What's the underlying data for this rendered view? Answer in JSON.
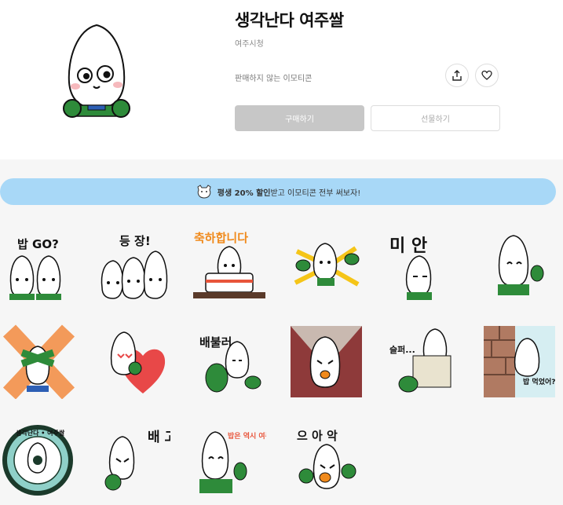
{
  "product": {
    "title": "생각난다 여주쌀",
    "author": "여주시청",
    "sale_status": "판매하지 않는 이모티콘",
    "buy_label": "구매하기",
    "gift_label": "선물하기"
  },
  "icons": {
    "share": "share-icon",
    "like": "heart-icon"
  },
  "banner": {
    "highlight": "평생 20% 할인",
    "rest": " 받고 이모티콘 전부 써보자!"
  },
  "stickers": [
    {
      "text": "밥 GO?"
    },
    {
      "text": "등 장!"
    },
    {
      "text": "축하합니다"
    },
    {
      "text": ""
    },
    {
      "text": "미 안"
    },
    {
      "text": ""
    },
    {
      "text": ""
    },
    {
      "text": ""
    },
    {
      "text": "배불러"
    },
    {
      "text": ""
    },
    {
      "text": "슬퍼..."
    },
    {
      "text": "밥 먹었어?"
    },
    {
      "text": "생각난다 • 여주쌀"
    },
    {
      "text": "배 고 파"
    },
    {
      "text": "밥은 역시 여주쌀!"
    },
    {
      "text": "으 아 악"
    }
  ],
  "colors": {
    "accent_green": "#2e8b3a",
    "banner_bg": "#a8d8f7",
    "buy_disabled": "#c7c7c7"
  }
}
